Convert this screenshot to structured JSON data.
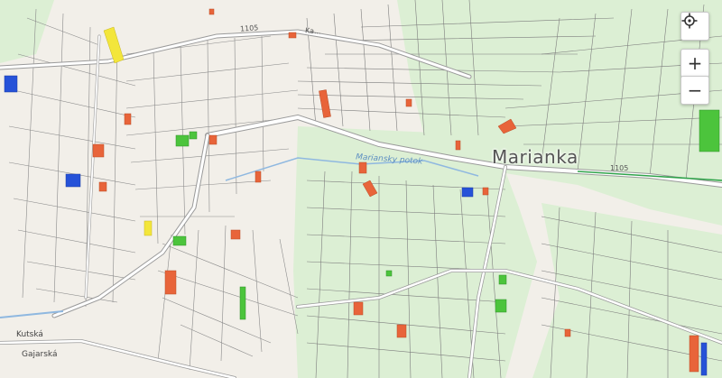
{
  "map": {
    "labels": {
      "town": "Marianka",
      "stream": "Mariansky potok",
      "kutska": "Kutská",
      "gajarska": "Gajarská",
      "road_top": "1105",
      "road_top2": "Ka...",
      "road_right": "1105"
    },
    "controls": {
      "locate_icon": "crosshair-locate-icon",
      "zoom_in_label": "+",
      "zoom_out_label": "−"
    },
    "colors": {
      "background": "#f2efe9",
      "forest": "#dcefd4",
      "parcel_line": "#7d7d7d",
      "road": "#ffffff",
      "orange": "#e8643a",
      "blue": "#2652d8",
      "yellow": "#f3e63b",
      "green": "#4cc43c",
      "water": "#8fb8e0"
    }
  }
}
